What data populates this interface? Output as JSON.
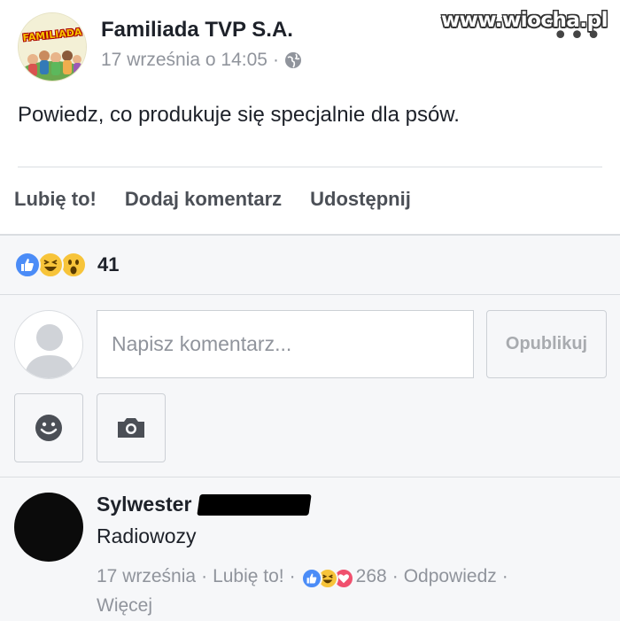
{
  "watermark": "www.wiocha.pl",
  "post": {
    "page_name": "Familiada TVP S.A.",
    "logo_text": "FAMILIADA",
    "timestamp": "17 września o 14:05",
    "meta_separator": "·",
    "privacy_icon": "globe-icon",
    "text": "Powiedz, co produkuje się specjalnie dla psów."
  },
  "actions": {
    "like": "Lubię to!",
    "comment": "Dodaj komentarz",
    "share": "Udostępnij"
  },
  "reactions": {
    "icons": [
      "like-icon",
      "haha-icon",
      "wow-icon"
    ],
    "count": "41"
  },
  "composer": {
    "placeholder": "Napisz komentarz...",
    "publish_label": "Opublikuj",
    "emoji_icon": "emoji-icon",
    "camera_icon": "camera-icon"
  },
  "comment": {
    "author": "Sylwester",
    "text": "Radiowozy",
    "date": "17 września",
    "like_label": "Lubię to!",
    "reaction_count": "268",
    "reply_label": "Odpowiedz",
    "more_label": "Więcej",
    "separator": "·"
  },
  "colors": {
    "like_blue": "#4b8cf7",
    "haha_yellow": "#f7c43a",
    "love_red": "#f0506e",
    "meta_gray": "#90949c"
  }
}
